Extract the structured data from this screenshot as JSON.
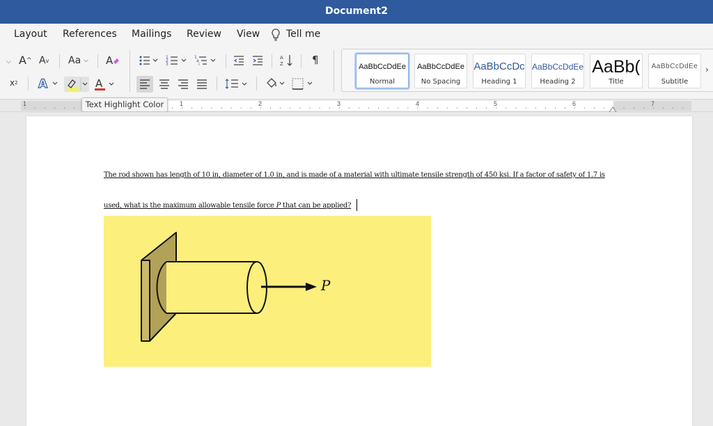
{
  "window": {
    "title": "Document2"
  },
  "menu": {
    "items": [
      "Layout",
      "References",
      "Mailings",
      "Review",
      "View"
    ],
    "tell_me": "Tell me"
  },
  "ribbon": {
    "change_case_label": "Aa",
    "styles": [
      {
        "sample": "AaBbCcDdEe",
        "name": "Normal",
        "selected": true
      },
      {
        "sample": "AaBbCcDdEe",
        "name": "No Spacing"
      },
      {
        "sample": "AaBbCcDc",
        "name": "Heading 1"
      },
      {
        "sample": "AaBbCcDdEe",
        "name": "Heading 2"
      },
      {
        "sample": "AaBb(",
        "name": "Title"
      },
      {
        "sample": "AaBbCcDdEe",
        "name": "Subtitle"
      }
    ],
    "colors": {
      "highlight": "#ffff00",
      "font_color": "#e0322a",
      "accent_blue": "#2f5a9e"
    }
  },
  "ruler": {
    "numbers": [
      "1",
      "1",
      "2",
      "3",
      "4",
      "5",
      "6",
      "7"
    ]
  },
  "tooltip": {
    "text": "Text Highlight Color"
  },
  "document": {
    "paragraph_line1": "The rod shown has length of 10 in, diameter of 1.0 in, and is made of a material with ultimate tensile strength of 450 ksi.  If a factor of safety of 1.7 is",
    "paragraph_line2_a": "used, what is the maximum allowable tensile force ",
    "paragraph_line2_p": "P",
    "paragraph_line2_b": " that can be applied?",
    "figure": {
      "force_label": "P",
      "background": "#fcef7c"
    }
  }
}
